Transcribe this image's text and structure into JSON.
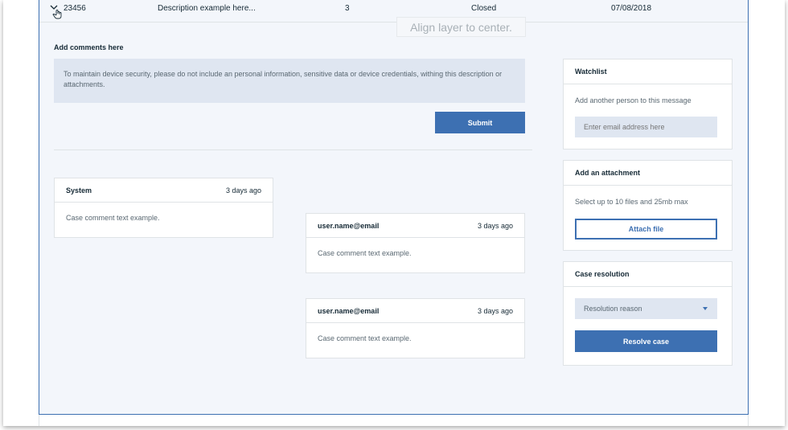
{
  "table_row": {
    "id": "23456",
    "description": "Description example here...",
    "count": "3",
    "status": "Closed",
    "date": "07/08/2018"
  },
  "tooltip": "Align layer to center.",
  "comments": {
    "label": "Add comments here",
    "notice": "To maintain device security, please do not include an personal information, sensitive data or device credentials, withing this description or attachments.",
    "submit_label": "Submit"
  },
  "thread": [
    {
      "author": "System",
      "time": "3 days ago",
      "text": "Case comment text example."
    },
    {
      "author": "user.name@email",
      "time": "3 days ago",
      "text": "Case comment text example."
    },
    {
      "author": "user.name@email",
      "time": "3 days ago",
      "text": "Case comment text example."
    }
  ],
  "watchlist": {
    "title": "Watchlist",
    "hint": "Add another person to this message",
    "email_placeholder": "Enter email address here"
  },
  "attachment": {
    "title": "Add an attachment",
    "hint": "Select up to 10 files and 25mb max",
    "button_label": "Attach file"
  },
  "resolution": {
    "title": "Case resolution",
    "select_value": "Resolution reason",
    "button_label": "Resolve case"
  },
  "colors": {
    "primary": "#3d70b2",
    "panel_bg": "#f3f6fb",
    "field_bg": "#dfe6f1",
    "text": "#152935"
  },
  "icons": {
    "row_toggle": "chevron-down-icon",
    "cursor": "hand-pointer-icon",
    "select_caret": "caret-down-icon"
  }
}
